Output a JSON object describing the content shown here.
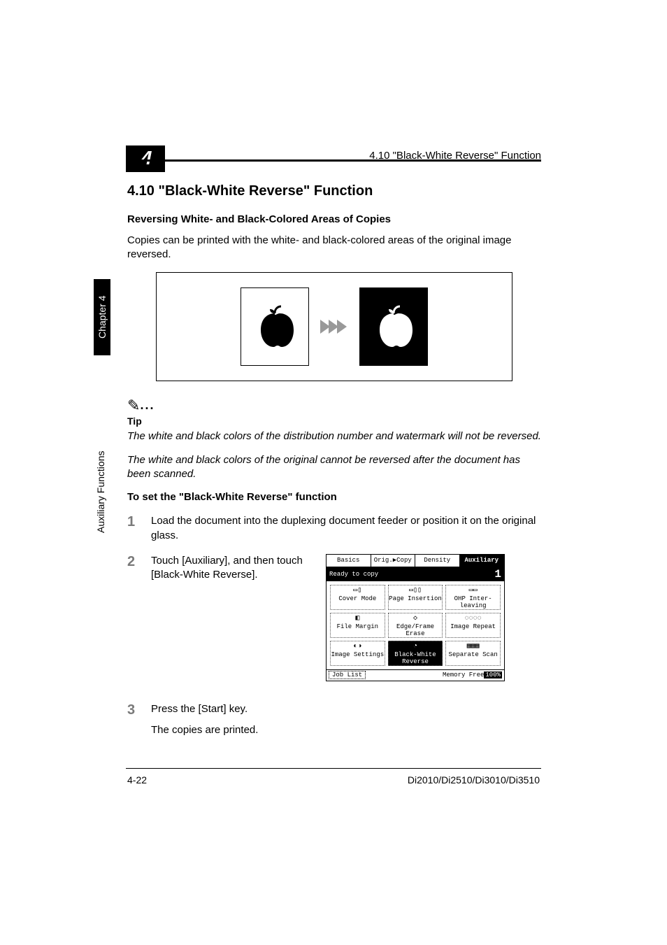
{
  "header": {
    "chapter_display": "4",
    "breadcrumb": "4.10 \"Black-White Reverse\" Function"
  },
  "side": {
    "chapter_label": "Chapter 4",
    "aux_label": "Auxiliary Functions"
  },
  "section": {
    "number_title": "4.10    \"Black-White Reverse\" Function",
    "subtitle": "Reversing White- and Black-Colored Areas of Copies",
    "intro": "Copies can be printed with the white- and black-colored areas of the original image reversed."
  },
  "tip": {
    "label": "Tip",
    "line1": "The white and black colors of the distribution number and watermark will not be reversed.",
    "line2": "The white and black colors of the original cannot be reversed after the document has been scanned."
  },
  "howto": {
    "heading": "To set the \"Black-White Reverse\" function",
    "steps": [
      {
        "n": "1",
        "text": "Load the document into the duplexing document feeder or position it on the original glass."
      },
      {
        "n": "2",
        "text": "Touch [Auxiliary], and then touch [Black-White Reverse]."
      },
      {
        "n": "3",
        "text": "Press the [Start] key."
      }
    ],
    "step3_sub": "The copies are printed."
  },
  "screen": {
    "tabs": [
      "Basics",
      "Orig.▶Copy",
      "Density",
      "Auxiliary"
    ],
    "selected_tab_index": 3,
    "status_text": "Ready to copy",
    "copy_count": "1",
    "buttons": [
      [
        {
          "label": "Cover Mode",
          "icon": "▭▯",
          "selected": false
        },
        {
          "label": "Page Insertion",
          "icon": "▭▯▯",
          "selected": false
        },
        {
          "label": "OHP Inter-leaving",
          "icon": "▭▭",
          "selected": false
        }
      ],
      [
        {
          "label": "File Margin",
          "icon": "◧",
          "selected": false
        },
        {
          "label": "Edge/Frame Erase",
          "icon": "◇",
          "selected": false
        },
        {
          "label": "Image Repeat",
          "icon": "◌◌◌◌",
          "selected": false
        }
      ],
      [
        {
          "label": "Image Settings",
          "icon": "◐◑",
          "selected": false
        },
        {
          "label": "Black-White Reverse",
          "icon": "◔",
          "selected": true
        },
        {
          "label": "Separate Scan",
          "icon": "▦▦▦",
          "selected": false
        }
      ]
    ],
    "job_list": "Job List",
    "memory_label": "Memory Free",
    "memory_pct": "100%"
  },
  "footer": {
    "page_num": "4-22",
    "models": "Di2010/Di2510/Di3010/Di3510"
  }
}
